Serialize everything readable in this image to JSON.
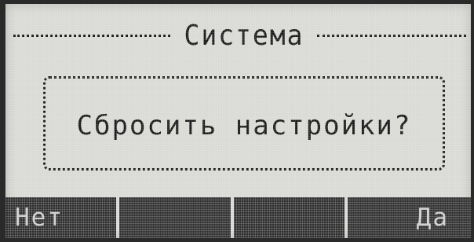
{
  "screen": {
    "title": "Система"
  },
  "dialog": {
    "message": "Сбросить настройки?"
  },
  "softkeys": [
    {
      "label": "Нет"
    },
    {
      "label": ""
    },
    {
      "label": ""
    },
    {
      "label": "Да"
    }
  ],
  "colors": {
    "lcd_background": "#d9d9d5",
    "foreground": "#1a1a1a",
    "softkey_background": "#2e2e2e",
    "softkey_text": "#cfcfcf",
    "bezel": "#2a2a2a"
  }
}
